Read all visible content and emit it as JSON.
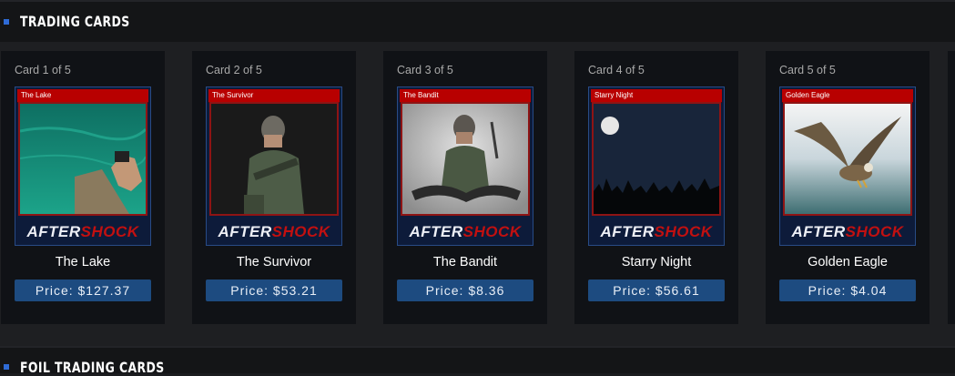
{
  "sections": {
    "trading_cards_title": "TRADING CARDS",
    "foil_trading_cards_title": "FOIL TRADING CARDS"
  },
  "brand": {
    "part1": "AFTER",
    "part2": "SHOCK"
  },
  "cards": [
    {
      "count": "Card 1 of 5",
      "label": "The Lake",
      "name": "The Lake",
      "price": "Price: $127.37"
    },
    {
      "count": "Card 2 of 5",
      "label": "The Survivor",
      "name": "The Survivor",
      "price": "Price: $53.21"
    },
    {
      "count": "Card 3 of 5",
      "label": "The Bandit",
      "name": "The Bandit",
      "price": "Price: $8.36"
    },
    {
      "count": "Card 4 of 5",
      "label": "Starry Night",
      "name": "Starry Night",
      "price": "Price: $56.61"
    },
    {
      "count": "Card 5 of 5",
      "label": "Golden Eagle",
      "name": "Golden Eagle",
      "price": "Price: $4.04"
    }
  ],
  "colors": {
    "accent_square": "#2f6bd6",
    "price_button": "#1d4b80",
    "card_label_bar": "#b80000",
    "brand_red": "#c21010"
  }
}
